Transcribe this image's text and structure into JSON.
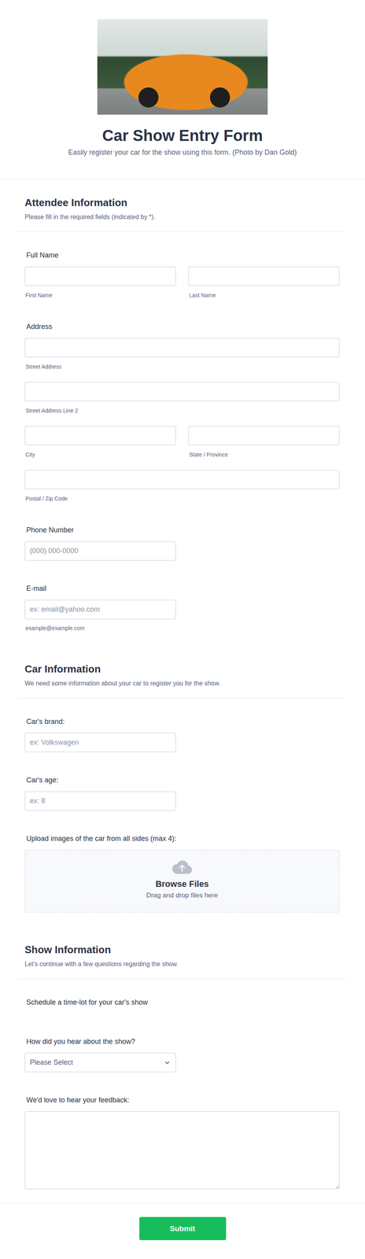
{
  "header": {
    "title": "Car Show Entry Form",
    "subtitle": "Easily register your car for the show using this form. (Photo by Dan Gold)"
  },
  "sections": [
    {
      "title": "Attendee Information",
      "description": "Please fill in the required fields (indicated by *).",
      "fields": [
        {
          "kind": "compound",
          "label": "Full Name",
          "rows": [
            [
              "First Name",
              "Last Name"
            ]
          ]
        },
        {
          "kind": "compound",
          "label": "Address",
          "rows": [
            [
              "Street Address"
            ],
            [
              "Street Address Line 2"
            ],
            [
              "City",
              "State / Province"
            ],
            [
              "Postal / Zip Code"
            ]
          ]
        },
        {
          "kind": "text",
          "label": "Phone Number",
          "placeholder": "(000) 000-0000"
        },
        {
          "kind": "text",
          "label": "E-mail",
          "placeholder": "ex: email@yahoo.com",
          "hint": "example@example.com"
        }
      ]
    },
    {
      "title": "Car Information",
      "description": "We need some information about your car to register you for the show.",
      "fields": [
        {
          "kind": "text",
          "label": "Car's brand:",
          "placeholder": "ex: Volkswagen"
        },
        {
          "kind": "text",
          "label": "Car's age:",
          "placeholder": "ex: 8"
        },
        {
          "kind": "upload",
          "label": "Upload images of the car from all sides (max 4):",
          "button": "Browse Files",
          "hint": "Drag and drop files here"
        }
      ]
    },
    {
      "title": "Show Information",
      "description": "Let's continue with a few questions regarding the show.",
      "fields": [
        {
          "kind": "heading",
          "label": "Schedule a time-lot for your car's show"
        },
        {
          "kind": "select",
          "label": "How did you hear about the show?",
          "value": "Please Select"
        },
        {
          "kind": "textarea",
          "label": "We'd love to hear your feedback:"
        }
      ]
    }
  ],
  "submit": "Submit"
}
